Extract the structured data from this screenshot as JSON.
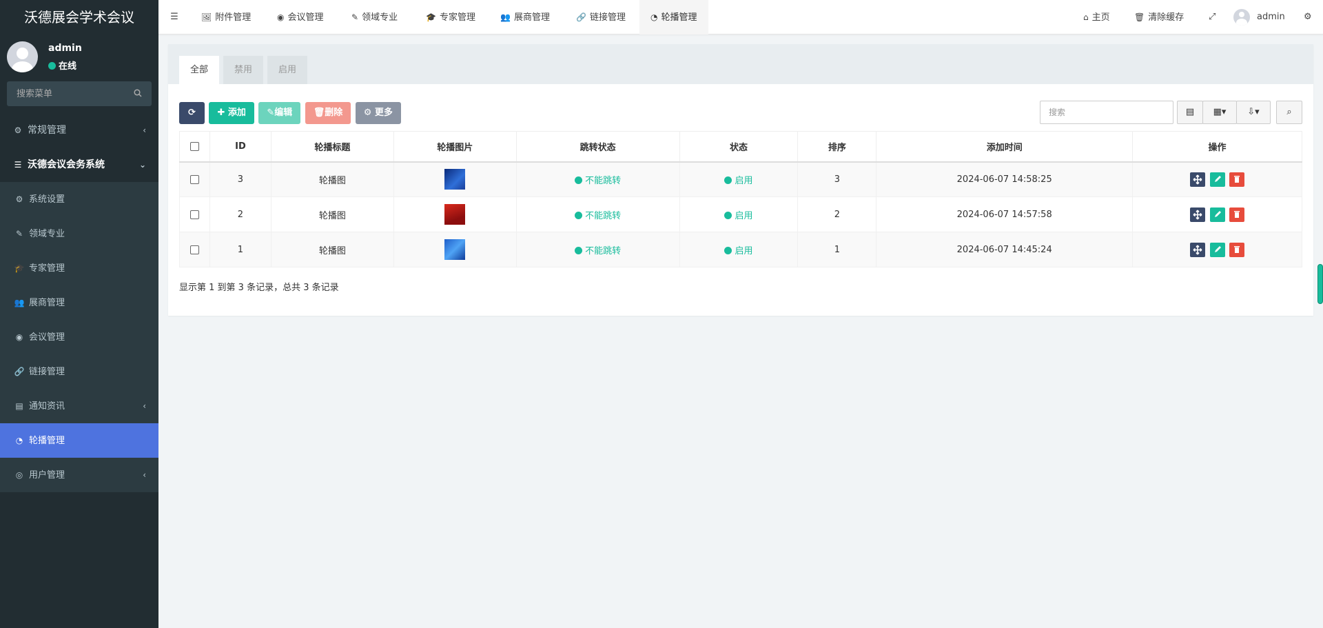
{
  "app": {
    "title": "沃德展会学术会议"
  },
  "user": {
    "name": "admin",
    "status": "在线"
  },
  "sidebar": {
    "search_placeholder": "搜索菜单",
    "items": [
      {
        "label": "常规管理",
        "icon": "cogs-icon",
        "has_children": true
      },
      {
        "label": "沃德会议会务系统",
        "icon": "bars-icon",
        "has_children": true,
        "expanded": true
      },
      {
        "label": "系统设置",
        "icon": "gear-icon"
      },
      {
        "label": "领域专业",
        "icon": "pencil-icon"
      },
      {
        "label": "专家管理",
        "icon": "graduation-cap-icon"
      },
      {
        "label": "展商管理",
        "icon": "users-icon"
      },
      {
        "label": "会议管理",
        "icon": "meeting-icon"
      },
      {
        "label": "链接管理",
        "icon": "link-icon"
      },
      {
        "label": "通知资讯",
        "icon": "newspaper-icon",
        "has_children": true
      },
      {
        "label": "轮播管理",
        "icon": "compass-icon",
        "active": true
      },
      {
        "label": "用户管理",
        "icon": "user-circle-icon",
        "has_children": true
      }
    ]
  },
  "topnav": {
    "tabs": [
      {
        "label": "附件管理",
        "icon": "image-icon"
      },
      {
        "label": "会议管理",
        "icon": "meeting-icon"
      },
      {
        "label": "领域专业",
        "icon": "pencil-icon"
      },
      {
        "label": "专家管理",
        "icon": "graduation-cap-icon"
      },
      {
        "label": "展商管理",
        "icon": "users-icon"
      },
      {
        "label": "链接管理",
        "icon": "link-icon"
      },
      {
        "label": "轮播管理",
        "icon": "compass-icon",
        "active": true
      }
    ],
    "home": "主页",
    "clear_cache": "清除缓存",
    "user": "admin"
  },
  "content": {
    "tabs": [
      "全部",
      "禁用",
      "启用"
    ],
    "toolbar": {
      "add": "添加",
      "edit": "编辑",
      "delete": "删除",
      "more": "更多"
    },
    "search_placeholder": "搜索",
    "columns": [
      "ID",
      "轮播标题",
      "轮播图片",
      "跳转状态",
      "状态",
      "排序",
      "添加时间",
      "操作"
    ],
    "rows": [
      {
        "id": "3",
        "title": "轮播图",
        "jump": "不能跳转",
        "status": "启用",
        "sort": "3",
        "time": "2024-06-07 14:58:25"
      },
      {
        "id": "2",
        "title": "轮播图",
        "jump": "不能跳转",
        "status": "启用",
        "sort": "2",
        "time": "2024-06-07 14:57:58"
      },
      {
        "id": "1",
        "title": "轮播图",
        "jump": "不能跳转",
        "status": "启用",
        "sort": "1",
        "time": "2024-06-07 14:45:24"
      }
    ],
    "pagination": "显示第 1 到第 3 条记录，总共 3 条记录"
  },
  "colors": {
    "sidebar_bg": "#222d32",
    "active_menu": "#4e73df",
    "success": "#18bc9c",
    "danger": "#e74c3c",
    "dark": "#3a4a6a"
  }
}
